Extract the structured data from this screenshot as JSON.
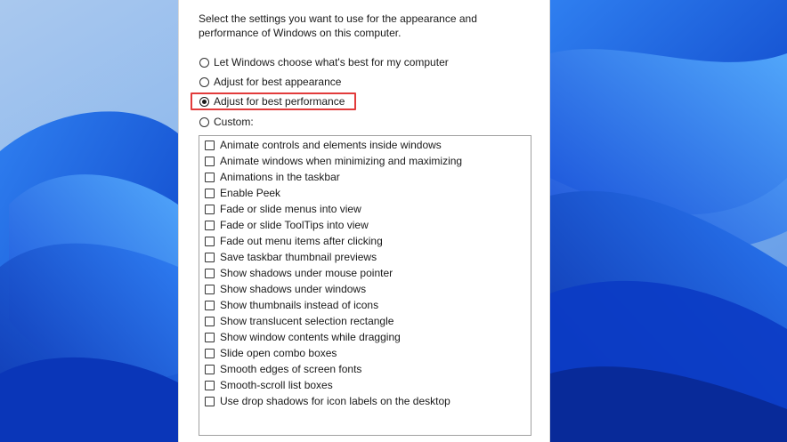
{
  "dialog": {
    "description": "Select the settings you want to use for the appearance and performance of Windows on this computer."
  },
  "options": [
    {
      "label": "Let Windows choose what's best for my computer",
      "checked": false
    },
    {
      "label": "Adjust for best appearance",
      "checked": false
    },
    {
      "label": "Adjust for best performance",
      "checked": true
    },
    {
      "label": "Custom:",
      "checked": false
    }
  ],
  "effects": [
    {
      "label": "Animate controls and elements inside windows",
      "checked": false
    },
    {
      "label": "Animate windows when minimizing and maximizing",
      "checked": false
    },
    {
      "label": "Animations in the taskbar",
      "checked": false
    },
    {
      "label": "Enable Peek",
      "checked": false
    },
    {
      "label": "Fade or slide menus into view",
      "checked": false
    },
    {
      "label": "Fade or slide ToolTips into view",
      "checked": false
    },
    {
      "label": "Fade out menu items after clicking",
      "checked": false
    },
    {
      "label": "Save taskbar thumbnail previews",
      "checked": false
    },
    {
      "label": "Show shadows under mouse pointer",
      "checked": false
    },
    {
      "label": "Show shadows under windows",
      "checked": false
    },
    {
      "label": "Show thumbnails instead of icons",
      "checked": false
    },
    {
      "label": "Show translucent selection rectangle",
      "checked": false
    },
    {
      "label": "Show window contents while dragging",
      "checked": false
    },
    {
      "label": "Slide open combo boxes",
      "checked": false
    },
    {
      "label": "Smooth edges of screen fonts",
      "checked": false
    },
    {
      "label": "Smooth-scroll list boxes",
      "checked": false
    },
    {
      "label": "Use drop shadows for icon labels on the desktop",
      "checked": false
    }
  ],
  "colors": {
    "highlight": "#e23b3b",
    "wallpaper_blue": "#1f5fe0"
  }
}
